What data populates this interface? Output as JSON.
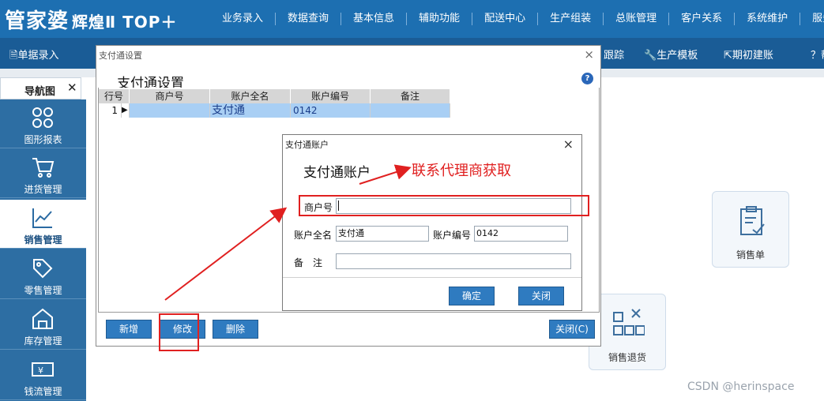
{
  "app": {
    "logo_main": "管家婆",
    "logo_sub": "辉煌Ⅱ TOP＋",
    "top_menu": [
      "业务录入",
      "数据查询",
      "基本信息",
      "辅助功能",
      "配送中心",
      "生产组装",
      "总账管理",
      "客户关系",
      "系统维护",
      "服务"
    ],
    "sub_menu": [
      "单据录入",
      "跟踪",
      "生产模板",
      "期初建账",
      "？帮"
    ]
  },
  "nav": {
    "tab_title": "导航图",
    "close": "✕",
    "items": [
      "图形报表",
      "进货管理",
      "销售管理",
      "零售管理",
      "库存管理",
      "钱流管理"
    ],
    "active_index": 2
  },
  "tiles": {
    "sales_order": "销售单",
    "sales_return": "销售退货"
  },
  "dialog": {
    "window_title": "支付通设置",
    "heading": "支付通设置",
    "close": "×",
    "help": "?",
    "columns": [
      "行号",
      "商户号",
      "账户全名",
      "账户编号",
      "备注"
    ],
    "rows": [
      {
        "row": "1",
        "merchant": "",
        "name": "支付通",
        "code": "0142",
        "note": ""
      }
    ],
    "buttons": {
      "add": "新增",
      "edit": "修改",
      "delete": "删除",
      "close": "关闭(C)"
    }
  },
  "subdialog": {
    "window_title": "支付通账户",
    "heading": "支付通账户",
    "close": "×",
    "merchant_label": "商户号",
    "merchant_value": "",
    "fullname_label": "账户全名",
    "fullname_value": "支付通",
    "code_label": "账户编号",
    "code_value": "0142",
    "note_label": "备　注",
    "note_value": "",
    "ok": "确定",
    "cancel": "关闭"
  },
  "annotation": {
    "text": "联系代理商获取",
    "color": "#e02020"
  },
  "watermark": "CSDN @herinspace"
}
